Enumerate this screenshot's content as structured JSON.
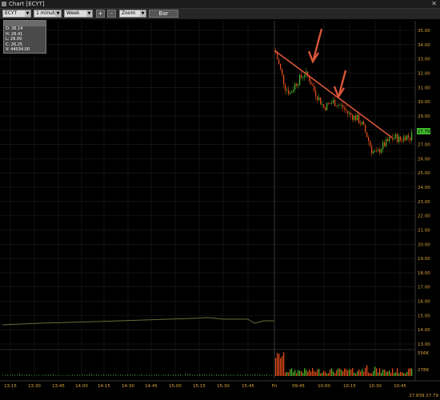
{
  "window": {
    "title": "Chart [ECYT]"
  },
  "toolbar": {
    "symbol": "ECYT",
    "interval": "1 minute",
    "range": "Week",
    "plus_label": "+",
    "minus_label": "-",
    "zoom": "Zoom",
    "bar_label": "Bar"
  },
  "infobox": {
    "header": "",
    "open": "O: 26.14",
    "high": "H: 26.41",
    "low": "L: 26.00",
    "close": "C: 26.25",
    "volume": "V: 44034.00"
  },
  "price_axis": {
    "labels": [
      "35.00",
      "34.00",
      "33.00",
      "32.00",
      "31.00",
      "30.00",
      "29.00",
      "28.00",
      "27.00",
      "26.00",
      "25.00",
      "24.00",
      "23.00",
      "22.00",
      "21.00",
      "20.00",
      "19.00",
      "18.00",
      "17.00",
      "16.00",
      "15.00",
      "14.00",
      "13.00"
    ],
    "current_price": "27.79"
  },
  "volume_axis": {
    "labels": [
      "556K",
      "278K"
    ]
  },
  "time_axis": {
    "labels": [
      "13:15",
      "13:30",
      "13:45",
      "14:00",
      "14:15",
      "14:30",
      "14:45",
      "15:00",
      "15:15",
      "15:30",
      "15:45",
      "Fri",
      "09:45",
      "10:00",
      "10:15",
      "10:30",
      "10:45"
    ]
  },
  "status": {
    "last_values": "27.839  27.79"
  },
  "colors": {
    "up": "#4caf2a",
    "down": "#e04b1a",
    "trendline": "#d9563a",
    "axis_text": "#d9a43a"
  }
}
